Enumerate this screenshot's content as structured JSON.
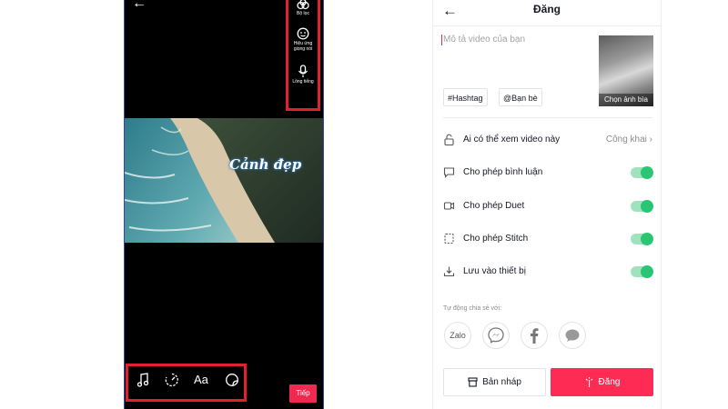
{
  "editor": {
    "tools": [
      {
        "label": "Bộ lọc",
        "icon": "filter-icon"
      },
      {
        "label": "Hiệu ứng giọng nói",
        "icon": "voice-effect-icon"
      },
      {
        "label": "Lồng tiếng",
        "icon": "microphone-icon"
      }
    ],
    "caption": "Cảnh đẹp",
    "bottom_tools": [
      "music-icon",
      "speed-icon",
      "text-icon",
      "sticker-icon"
    ],
    "text_tool_label": "Aa",
    "next_label": "Tiếp"
  },
  "post": {
    "title": "Đăng",
    "description_placeholder": "Mô tả video của bạn",
    "cover_label": "Chọn ảnh bìa",
    "hashtag_label": "#Hashtag",
    "friends_label": "@Bạn bè",
    "privacy": {
      "label": "Ai có thể xem video này",
      "value": "Công khai"
    },
    "settings": [
      {
        "label": "Cho phép bình luận",
        "enabled": true,
        "icon": "comment-icon"
      },
      {
        "label": "Cho phép Duet",
        "enabled": true,
        "icon": "duet-icon"
      },
      {
        "label": "Cho phép Stitch",
        "enabled": true,
        "icon": "stitch-icon"
      },
      {
        "label": "Lưu vào thiết bị",
        "enabled": true,
        "icon": "download-icon"
      }
    ],
    "share_label": "Tự động chia sẻ với:",
    "share_targets": [
      {
        "label": "Zalo",
        "icon": "zalo-icon"
      },
      {
        "icon": "messenger-icon"
      },
      {
        "icon": "facebook-icon"
      },
      {
        "icon": "message-icon"
      }
    ],
    "draft_label": "Bản nháp",
    "post_label": "Đăng"
  },
  "colors": {
    "accent": "#fe2c55",
    "toggle_on": "#2bc673",
    "highlight_box": "#e2202f"
  }
}
